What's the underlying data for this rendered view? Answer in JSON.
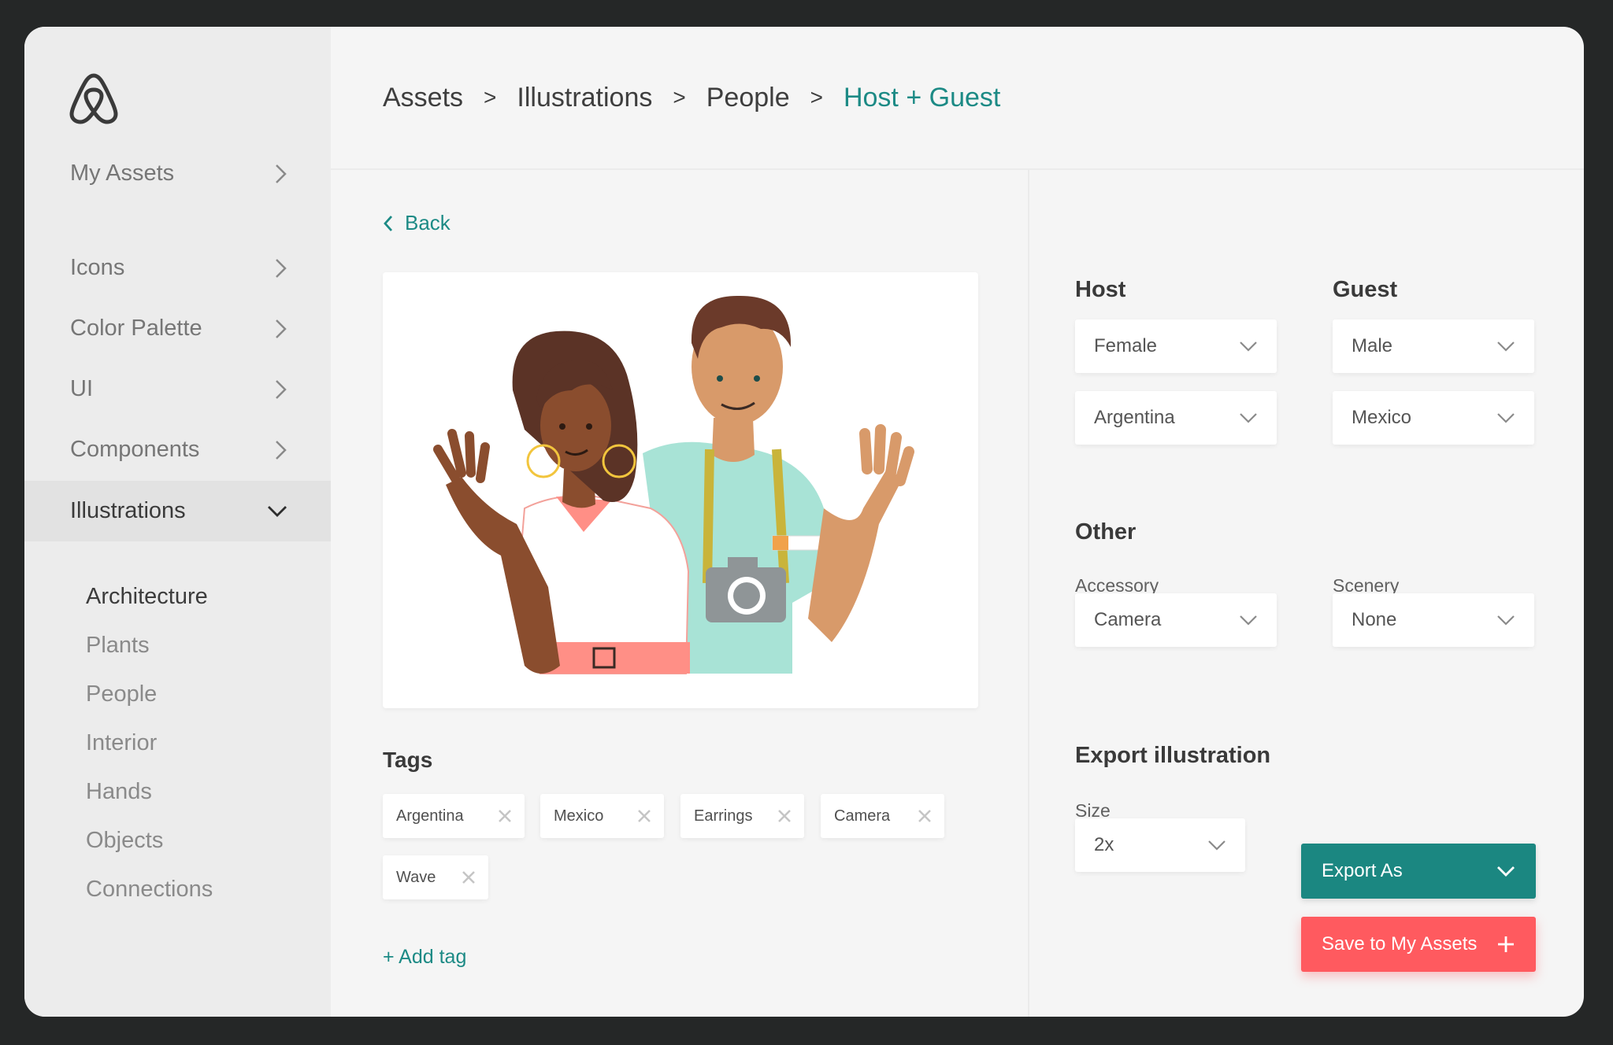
{
  "sidebar": {
    "items": [
      {
        "label": "My Assets"
      },
      {
        "label": "Icons"
      },
      {
        "label": "Color Palette"
      },
      {
        "label": "UI"
      },
      {
        "label": "Components"
      },
      {
        "label": "Illustrations"
      }
    ],
    "subitems": [
      {
        "label": "Architecture"
      },
      {
        "label": "Plants"
      },
      {
        "label": "People"
      },
      {
        "label": "Interior"
      },
      {
        "label": "Hands"
      },
      {
        "label": "Objects"
      },
      {
        "label": "Connections"
      }
    ]
  },
  "breadcrumb": {
    "items": [
      "Assets",
      "Illustrations",
      "People",
      "Host + Guest"
    ],
    "separator": ">"
  },
  "back_label": "Back",
  "tags": {
    "title": "Tags",
    "items": [
      "Argentina",
      "Mexico",
      "Earrings",
      "Camera",
      "Wave"
    ],
    "add_label": "+ Add tag"
  },
  "host": {
    "title": "Host",
    "gender": "Female",
    "country": "Argentina"
  },
  "guest": {
    "title": "Guest",
    "gender": "Male",
    "country": "Mexico"
  },
  "other": {
    "title": "Other",
    "accessory_label": "Accessory",
    "accessory_value": "Camera",
    "scenery_label": "Scenery",
    "scenery_value": "None"
  },
  "export": {
    "title": "Export illustration",
    "size_label": "Size",
    "size_value": "2x",
    "export_button": "Export As",
    "save_button": "Save to My Assets"
  },
  "colors": {
    "accent_teal": "#1b8781",
    "accent_coral": "#ff5a5f"
  },
  "icons": [
    "airbnb-logo-icon",
    "chevron-right-icon",
    "chevron-down-icon",
    "chevron-left-icon",
    "close-icon",
    "plus-icon"
  ]
}
